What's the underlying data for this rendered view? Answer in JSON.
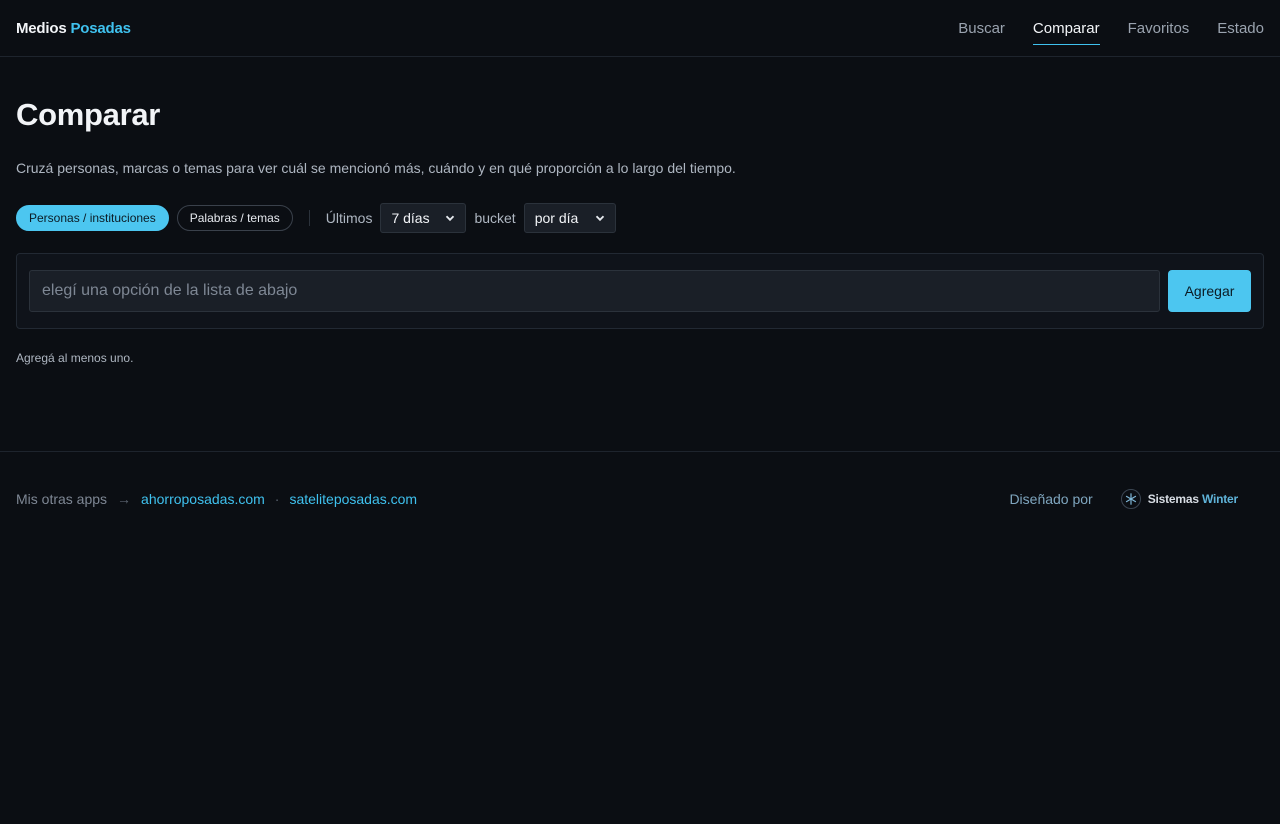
{
  "brand": {
    "part1": "Medios",
    "part2": "Posadas"
  },
  "nav": {
    "items": [
      {
        "label": "Buscar"
      },
      {
        "label": "Comparar"
      },
      {
        "label": "Favoritos"
      },
      {
        "label": "Estado"
      }
    ],
    "active": "Comparar"
  },
  "page": {
    "title": "Comparar",
    "subtitle": "Cruzá personas, marcas o temas para ver cuál se mencionó más, cuándo y en qué proporción a lo largo del tiempo."
  },
  "controls": {
    "mode_on": "Personas / instituciones",
    "mode_off": "Palabras / temas",
    "range_label": "Últimos",
    "range_value": "7 días",
    "bucket_label": "bucket",
    "bucket_value": "por día"
  },
  "entry": {
    "placeholder": "elegí una opción de la lista de abajo",
    "add_label": "Agregar",
    "hint": "Agregá al menos uno."
  },
  "footer": {
    "other_apps": "Mis otras apps",
    "arrow": "→",
    "link1": "ahorroposadas.com",
    "sep": "·",
    "link2": "sateliteposadas.com",
    "designed_by": "Diseñado por",
    "company_part1": "Sistemas",
    "company_part2": "Winter"
  },
  "colors": {
    "accent": "#4cc6f0",
    "background": "#0b0e13"
  },
  "icons": {
    "select_chevron": "chevron-down-icon",
    "company_logo": "snowflake-icon"
  }
}
